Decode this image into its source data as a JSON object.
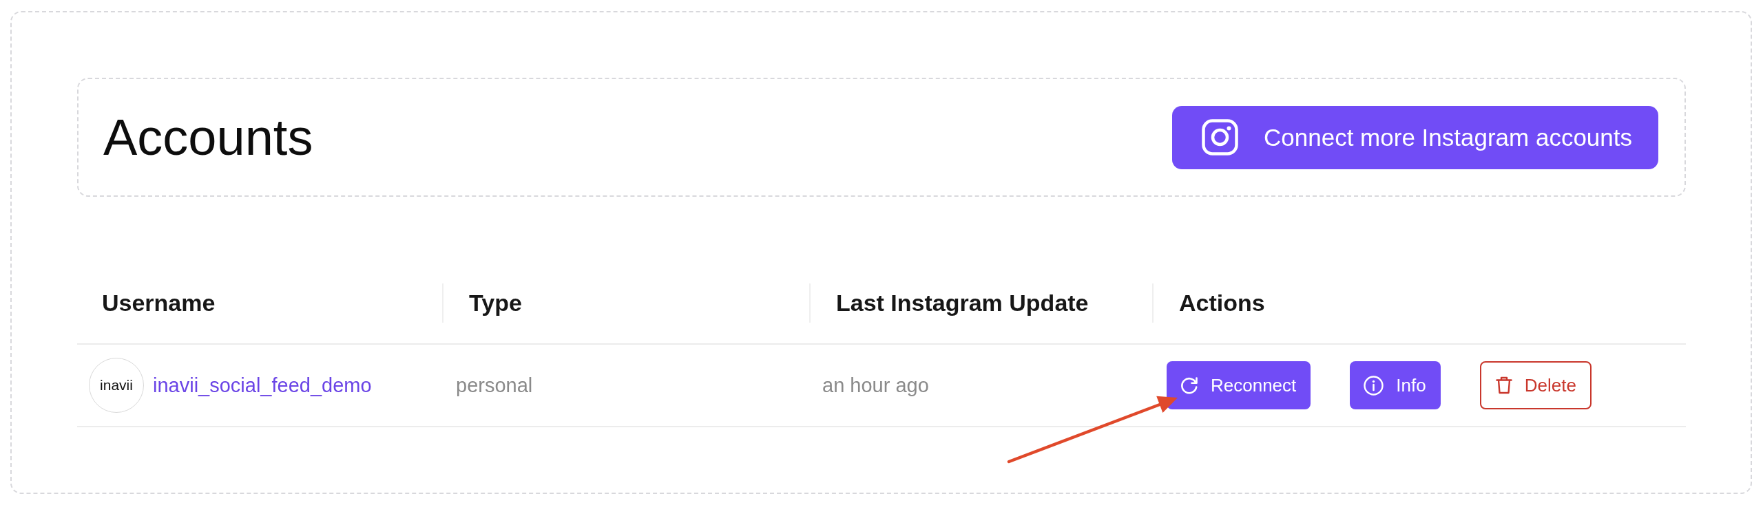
{
  "header": {
    "title": "Accounts",
    "connect_button": {
      "label": "Connect more Instagram accounts"
    }
  },
  "table": {
    "columns": [
      "Username",
      "Type",
      "Last Instagram Update",
      "Actions"
    ],
    "rows": [
      {
        "avatar_text": "inavii",
        "username": "inavii_social_feed_demo",
        "type": "personal",
        "last_update": "an hour ago",
        "actions": [
          {
            "kind": "reconnect",
            "label": "Reconnect"
          },
          {
            "kind": "info",
            "label": "Info"
          },
          {
            "kind": "delete",
            "label": "Delete"
          }
        ]
      }
    ]
  },
  "annotations": [
    {
      "kind": "arrow"
    }
  ]
}
